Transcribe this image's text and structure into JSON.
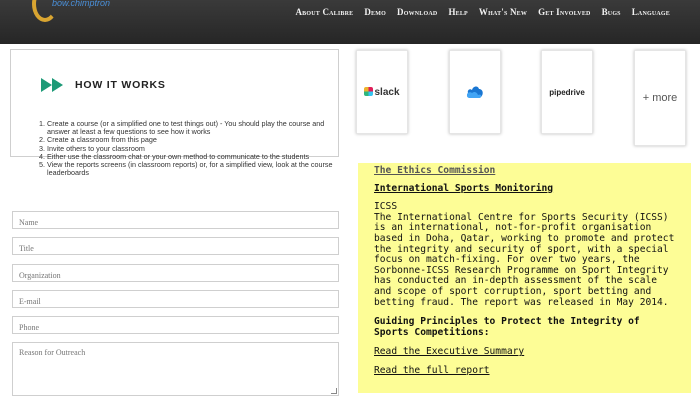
{
  "header": {
    "logo_text": "bow.chimptron",
    "nav": [
      "About Calibre",
      "Demo",
      "Download",
      "Help",
      "What's New",
      "Get Involved",
      "Bugs",
      "Language"
    ]
  },
  "how_it_works": {
    "title": "HOW IT WORKS",
    "steps": [
      "Create a course (or a simplified one to test things out) - You should play the course and answer at least a few questions to see how it works",
      "Create a classroom from this page",
      "Invite others to your classroom",
      "Either use the classroom chat or your own method to communicate to the students",
      "View the reports screens (in classroom reports) or, for a simplified view, look at the course leaderboards"
    ]
  },
  "form": {
    "name_placeholder": "Name",
    "title_placeholder": "Title",
    "organization_placeholder": "Organization",
    "email_placeholder": "E-mail",
    "phone_placeholder": "Phone",
    "reason_placeholder": "Reason for Outreach"
  },
  "integrations": {
    "slack": "slack",
    "cloud": "cloud-icon",
    "pipedrive": "pipedrive",
    "more": "+ more"
  },
  "panel": {
    "link1": "The Ethics Commission",
    "link2": "International Sports Monitoring",
    "heading": "ICSS",
    "body": "The International Centre for Sports Security (ICSS) is an international, not-for-profit organisation based in Doha, Qatar, working to promote and protect the integrity and security of sport, with a special focus on match-fixing. For over two years, the Sorbonne-ICSS Research Programme on Sport Integrity has conducted an in-depth assessment of the scale and scope of sport corruption, sport betting and betting fraud. The report was released in May 2014.",
    "subheading": "Guiding Principles to Protect the Integrity of Sports Competitions:",
    "link3": "Read the Executive Summary",
    "link4": "Read the full report",
    "bg_color": "#fdfd96"
  }
}
